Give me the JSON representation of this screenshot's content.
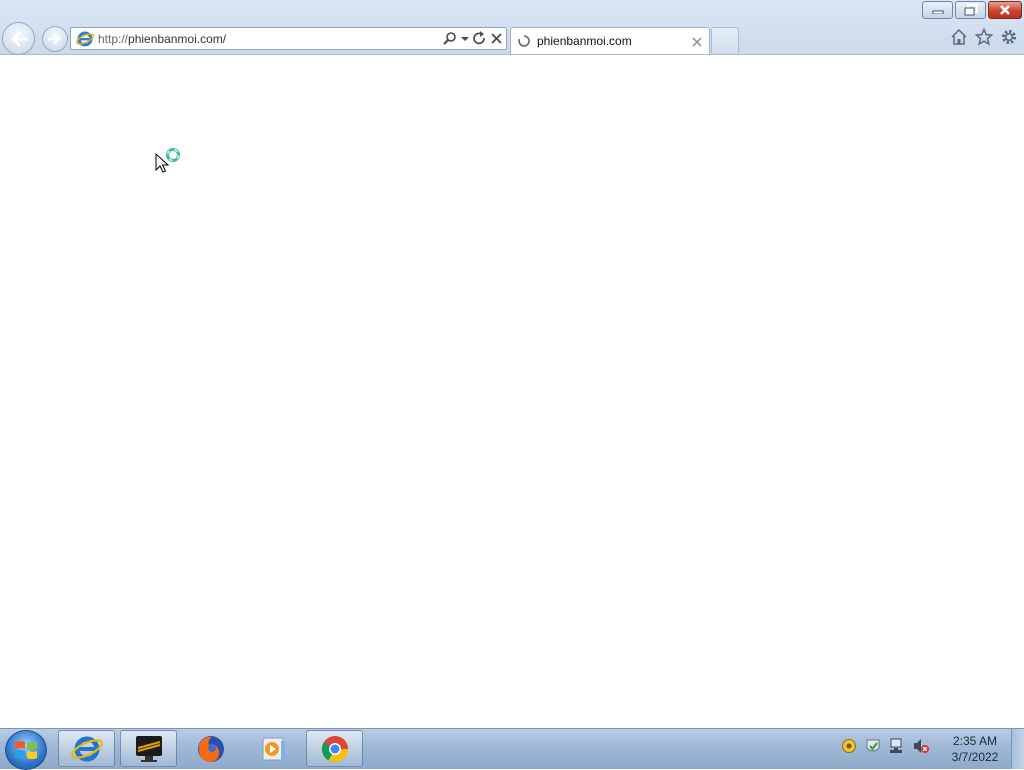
{
  "window": {
    "minimize_icon": "minimize-icon",
    "restore_icon": "restore-icon",
    "close_icon": "close-icon",
    "close_color": "#c6462f"
  },
  "nav": {
    "back_icon": "back-arrow-icon",
    "forward_icon": "forward-arrow-icon"
  },
  "address": {
    "protocol": "http://",
    "host": "phienbanmoi.com/",
    "tools": [
      "search-icon",
      "dropdown-icon",
      "refresh-icon",
      "stop-icon"
    ]
  },
  "tab": {
    "title": "phienbanmoi.com",
    "status": "loading"
  },
  "toolbar_right": [
    "home-icon",
    "favorites-star-icon",
    "settings-gear-icon"
  ],
  "taskbar": {
    "pinned": [
      "internet-explorer-icon",
      "cm-monitor-icon",
      "firefox-icon",
      "media-player-icon",
      "chrome-icon"
    ],
    "tray": [
      "network-icon",
      "security-center-icon",
      "network-connection-icon",
      "volume-muted-icon"
    ],
    "clock_time": "2:35 AM",
    "clock_date": "3/7/2022"
  }
}
